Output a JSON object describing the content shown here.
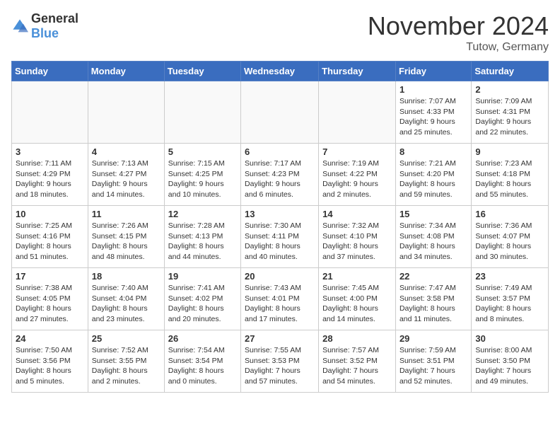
{
  "header": {
    "logo_general": "General",
    "logo_blue": "Blue",
    "month_title": "November 2024",
    "location": "Tutow, Germany"
  },
  "days_of_week": [
    "Sunday",
    "Monday",
    "Tuesday",
    "Wednesday",
    "Thursday",
    "Friday",
    "Saturday"
  ],
  "weeks": [
    [
      {
        "day": "",
        "info": ""
      },
      {
        "day": "",
        "info": ""
      },
      {
        "day": "",
        "info": ""
      },
      {
        "day": "",
        "info": ""
      },
      {
        "day": "",
        "info": ""
      },
      {
        "day": "1",
        "info": "Sunrise: 7:07 AM\nSunset: 4:33 PM\nDaylight: 9 hours\nand 25 minutes."
      },
      {
        "day": "2",
        "info": "Sunrise: 7:09 AM\nSunset: 4:31 PM\nDaylight: 9 hours\nand 22 minutes."
      }
    ],
    [
      {
        "day": "3",
        "info": "Sunrise: 7:11 AM\nSunset: 4:29 PM\nDaylight: 9 hours\nand 18 minutes."
      },
      {
        "day": "4",
        "info": "Sunrise: 7:13 AM\nSunset: 4:27 PM\nDaylight: 9 hours\nand 14 minutes."
      },
      {
        "day": "5",
        "info": "Sunrise: 7:15 AM\nSunset: 4:25 PM\nDaylight: 9 hours\nand 10 minutes."
      },
      {
        "day": "6",
        "info": "Sunrise: 7:17 AM\nSunset: 4:23 PM\nDaylight: 9 hours\nand 6 minutes."
      },
      {
        "day": "7",
        "info": "Sunrise: 7:19 AM\nSunset: 4:22 PM\nDaylight: 9 hours\nand 2 minutes."
      },
      {
        "day": "8",
        "info": "Sunrise: 7:21 AM\nSunset: 4:20 PM\nDaylight: 8 hours\nand 59 minutes."
      },
      {
        "day": "9",
        "info": "Sunrise: 7:23 AM\nSunset: 4:18 PM\nDaylight: 8 hours\nand 55 minutes."
      }
    ],
    [
      {
        "day": "10",
        "info": "Sunrise: 7:25 AM\nSunset: 4:16 PM\nDaylight: 8 hours\nand 51 minutes."
      },
      {
        "day": "11",
        "info": "Sunrise: 7:26 AM\nSunset: 4:15 PM\nDaylight: 8 hours\nand 48 minutes."
      },
      {
        "day": "12",
        "info": "Sunrise: 7:28 AM\nSunset: 4:13 PM\nDaylight: 8 hours\nand 44 minutes."
      },
      {
        "day": "13",
        "info": "Sunrise: 7:30 AM\nSunset: 4:11 PM\nDaylight: 8 hours\nand 40 minutes."
      },
      {
        "day": "14",
        "info": "Sunrise: 7:32 AM\nSunset: 4:10 PM\nDaylight: 8 hours\nand 37 minutes."
      },
      {
        "day": "15",
        "info": "Sunrise: 7:34 AM\nSunset: 4:08 PM\nDaylight: 8 hours\nand 34 minutes."
      },
      {
        "day": "16",
        "info": "Sunrise: 7:36 AM\nSunset: 4:07 PM\nDaylight: 8 hours\nand 30 minutes."
      }
    ],
    [
      {
        "day": "17",
        "info": "Sunrise: 7:38 AM\nSunset: 4:05 PM\nDaylight: 8 hours\nand 27 minutes."
      },
      {
        "day": "18",
        "info": "Sunrise: 7:40 AM\nSunset: 4:04 PM\nDaylight: 8 hours\nand 23 minutes."
      },
      {
        "day": "19",
        "info": "Sunrise: 7:41 AM\nSunset: 4:02 PM\nDaylight: 8 hours\nand 20 minutes."
      },
      {
        "day": "20",
        "info": "Sunrise: 7:43 AM\nSunset: 4:01 PM\nDaylight: 8 hours\nand 17 minutes."
      },
      {
        "day": "21",
        "info": "Sunrise: 7:45 AM\nSunset: 4:00 PM\nDaylight: 8 hours\nand 14 minutes."
      },
      {
        "day": "22",
        "info": "Sunrise: 7:47 AM\nSunset: 3:58 PM\nDaylight: 8 hours\nand 11 minutes."
      },
      {
        "day": "23",
        "info": "Sunrise: 7:49 AM\nSunset: 3:57 PM\nDaylight: 8 hours\nand 8 minutes."
      }
    ],
    [
      {
        "day": "24",
        "info": "Sunrise: 7:50 AM\nSunset: 3:56 PM\nDaylight: 8 hours\nand 5 minutes."
      },
      {
        "day": "25",
        "info": "Sunrise: 7:52 AM\nSunset: 3:55 PM\nDaylight: 8 hours\nand 2 minutes."
      },
      {
        "day": "26",
        "info": "Sunrise: 7:54 AM\nSunset: 3:54 PM\nDaylight: 8 hours\nand 0 minutes."
      },
      {
        "day": "27",
        "info": "Sunrise: 7:55 AM\nSunset: 3:53 PM\nDaylight: 7 hours\nand 57 minutes."
      },
      {
        "day": "28",
        "info": "Sunrise: 7:57 AM\nSunset: 3:52 PM\nDaylight: 7 hours\nand 54 minutes."
      },
      {
        "day": "29",
        "info": "Sunrise: 7:59 AM\nSunset: 3:51 PM\nDaylight: 7 hours\nand 52 minutes."
      },
      {
        "day": "30",
        "info": "Sunrise: 8:00 AM\nSunset: 3:50 PM\nDaylight: 7 hours\nand 49 minutes."
      }
    ]
  ]
}
